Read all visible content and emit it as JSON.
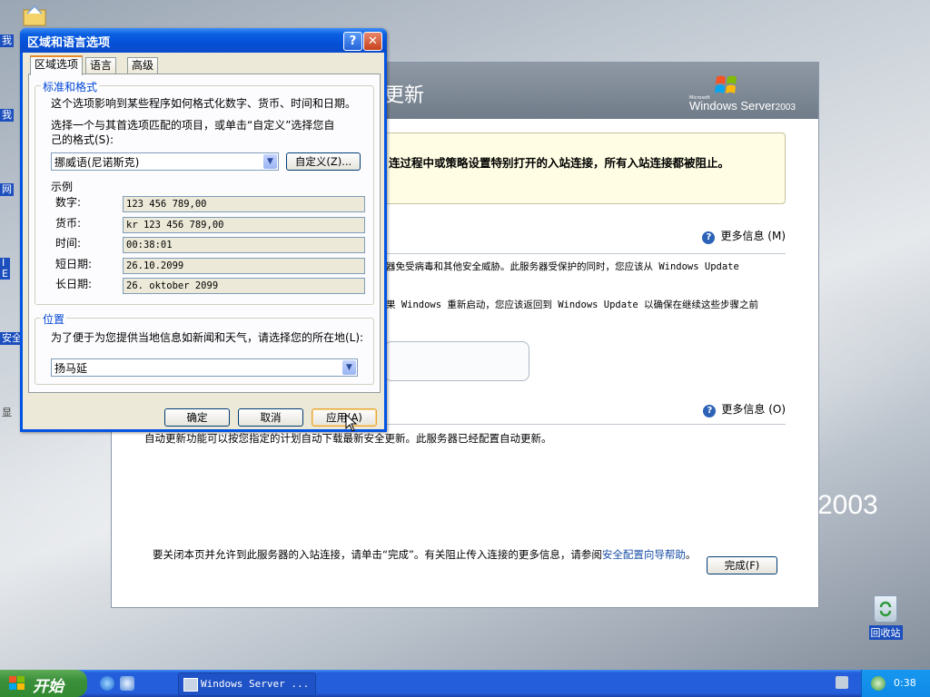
{
  "desktop": {
    "icon_labels": [
      "我",
      "我",
      "网",
      "I\nE",
      "安全",
      "显"
    ],
    "brand_text": "2003",
    "recycle_bin_label": "回收站"
  },
  "scw": {
    "title_fragment": "更新",
    "logo_small": "Microsoft",
    "logo_name": "Windows Server",
    "logo_year": "2003",
    "warning": "连过程中或策略设置特别打开的入站连接，所有入站连接都被阻止。",
    "more_info_1": "更多信息",
    "more_info_1_key": "(M)",
    "para1": "器免受病毒和其他安全威胁。此服务器受保护的同时，您应该从 Windows Update",
    "para2": "果 Windows 重新启动，您应该返回到 Windows Update 以确保在继续这些步骤之前",
    "more_info_2": "更多信息",
    "more_info_2_key": "(O)",
    "auto_update_text": "自动更新功能可以按您指定的计划自动下载最新安全更新。此服务器已经配置自动更新。",
    "finish_text_a": "要关闭本页并允许到此服务器的入站连接，请单击“完成”。有关阻止传入连接的更多信息，请参阅",
    "finish_link": "安全配置向导帮助",
    "finish_text_b": "。",
    "finish_button": "完成(F)"
  },
  "dialog": {
    "title": "区域和语言选项",
    "help_glyph": "?",
    "close_glyph": "✕",
    "tabs": [
      {
        "label": "区域选项",
        "active": true
      },
      {
        "label": "语言",
        "active": false
      },
      {
        "label": "高级",
        "active": false
      }
    ],
    "standards": {
      "group_label": "标准和格式",
      "description": "这个选项影响到某些程序如何格式化数字、货币、时间和日期。",
      "select_prompt_1": "选择一个与其首选项匹配的项目，或单击“自定义”选择您自",
      "select_prompt_2": "己的格式(S):",
      "format_value": "挪威语(尼诺斯克)",
      "customize_button": "自定义(Z)...",
      "sample_label": "示例",
      "samples": [
        {
          "label": "数字:",
          "value": "123 456 789,00"
        },
        {
          "label": "货币:",
          "value": "kr 123 456 789,00"
        },
        {
          "label": "时间:",
          "value": "00:38:01"
        },
        {
          "label": "短日期:",
          "value": "26.10.2099"
        },
        {
          "label": "长日期:",
          "value": "26. oktober 2099"
        }
      ]
    },
    "location": {
      "group_label": "位置",
      "description": "为了便于为您提供当地信息如新闻和天气，请选择您的所在地(L):",
      "value": "扬马延"
    },
    "buttons": {
      "ok": "确定",
      "cancel": "取消",
      "apply": "应用(A)"
    }
  },
  "taskbar": {
    "start_label": "开始",
    "task_button": "Windows Server ...",
    "clock": "0:38"
  },
  "colors": {
    "xp_blue": "#0054e3",
    "dialog_face": "#ece9d8",
    "start_green": "#3c8f3b",
    "taskbar_blue": "#245edb",
    "group_label_blue": "#0046d5"
  },
  "icons": [
    "folder-icon",
    "help-icon",
    "close-icon",
    "windows-flag-icon",
    "ie-icon",
    "recycle-bin-icon",
    "mouse-cursor-icon"
  ]
}
